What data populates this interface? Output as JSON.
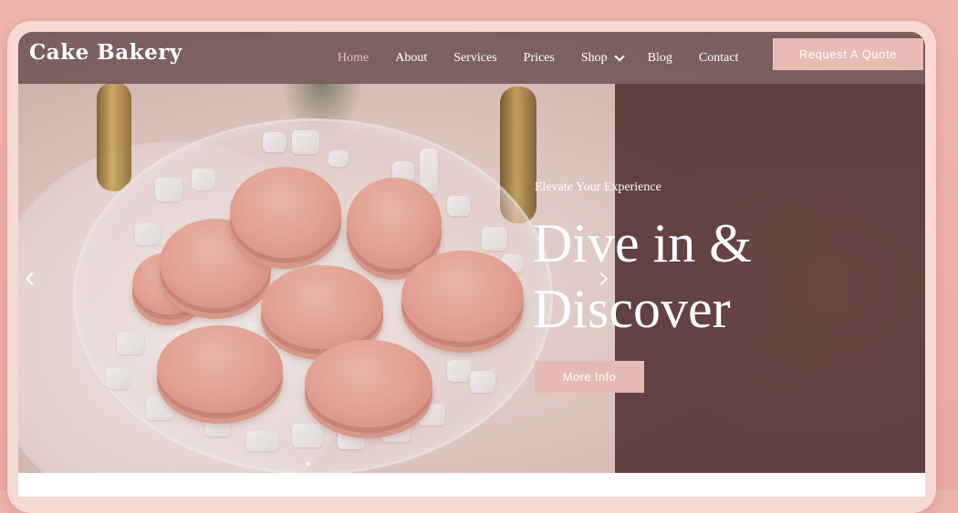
{
  "header": {
    "logo_text": "Cake Bakery",
    "nav": [
      {
        "label": "Home",
        "active": true
      },
      {
        "label": "About"
      },
      {
        "label": "Services"
      },
      {
        "label": "Prices"
      },
      {
        "label": "Shop",
        "has_dropdown": true
      },
      {
        "label": "Blog"
      },
      {
        "label": "Contact"
      }
    ],
    "cta_label": "Request A Quote"
  },
  "hero": {
    "eyebrow": "Elevate Your Experience",
    "headline_line1": "Dive in &",
    "headline_line2": "Discover",
    "button_label": "More Info",
    "prev_icon": "chevron-left-icon",
    "next_icon": "chevron-right-icon"
  },
  "colors": {
    "page_bg": "#eab3ac",
    "header_bg": "#694e4e",
    "overlay_panel": "#5c3b3b",
    "accent": "#e8bcb5",
    "active_nav": "#e9c3bb"
  }
}
